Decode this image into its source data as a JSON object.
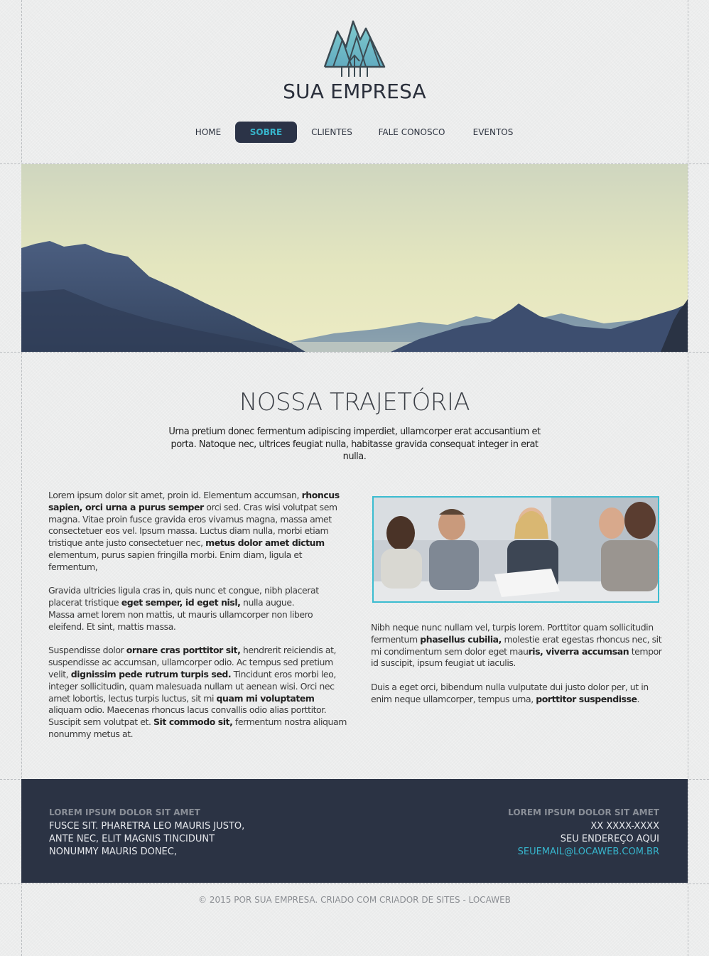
{
  "brand": {
    "name": "SUA EMPRESA",
    "logo_icon": "tree-mountain-logo"
  },
  "nav": {
    "items": [
      {
        "label": "HOME",
        "active": false
      },
      {
        "label": "SOBRE",
        "active": true
      },
      {
        "label": "CLIENTES",
        "active": false
      },
      {
        "label": "FALE CONOSCO",
        "active": false
      },
      {
        "label": "EVENTOS",
        "active": false
      }
    ]
  },
  "section": {
    "title": "NOSSA TRAJETÓRIA",
    "intro": "Urna pretium donec fermentum adipiscing imperdiet, ullamcorper erat accusantium et porta. Natoque nec, ultrices feugiat nulla, habitasse gravida consequat integer in erat nulla."
  },
  "left_column": {
    "p1": [
      {
        "t": "Lorem ipsum dolor sit amet, proin id. Elementum accumsan, ",
        "b": false
      },
      {
        "t": "rhoncus sapien, orci urna a purus semper",
        "b": true
      },
      {
        "t": " orci sed. Cras wisi volutpat sem magna. Vitae proin fusce gravida eros vivamus magna, massa amet consectetuer eos vel. Ipsum massa. Luctus diam nulla, morbi etiam tristique ante justo consectetuer nec, ",
        "b": false
      },
      {
        "t": "metus dolor amet dictum",
        "b": true
      },
      {
        "t": " elementum, purus sapien fringilla morbi. Enim diam, ligula et fermentum,",
        "b": false
      }
    ],
    "p2": [
      {
        "t": "Gravida ultricies ligula cras in, quis nunc et congue, nibh placerat placerat tristique ",
        "b": false
      },
      {
        "t": "eget semper, id eget nisl,",
        "b": true
      },
      {
        "t": " nulla augue.",
        "b": false
      },
      {
        "t": "\n",
        "b": false
      },
      {
        "t": "Massa amet lorem non mattis, ut mauris ullamcorper non libero eleifend. Et sint, mattis massa.",
        "b": false
      }
    ],
    "p3": [
      {
        "t": "Suspendisse dolor ",
        "b": false
      },
      {
        "t": "ornare cras porttitor sit,",
        "b": true
      },
      {
        "t": " hendrerit reiciendis at, suspendisse ac accumsan, ullamcorper odio. Ac tempus sed pretium velit, ",
        "b": false
      },
      {
        "t": "dignissim pede rutrum turpis sed.",
        "b": true
      },
      {
        "t": " Tincidunt eros morbi leo, integer sollicitudin, quam malesuada nullam ut aenean wisi. Orci nec amet lobortis, lectus turpis luctus, sit mi ",
        "b": false
      },
      {
        "t": "quam mi voluptatem",
        "b": true
      },
      {
        "t": " aliquam odio. Maecenas rhoncus lacus convallis odio alias porttitor. Suscipit sem volutpat et. ",
        "b": false
      },
      {
        "t": "Sit commodo sit,",
        "b": true
      },
      {
        "t": " fermentum nostra aliquam nonummy metus at.",
        "b": false
      }
    ]
  },
  "right_column": {
    "photo_alt": "business-meeting-photo",
    "p1": [
      {
        "t": "Nibh neque nunc nullam vel, turpis lorem. Porttitor quam sollicitudin fermentum ",
        "b": false
      },
      {
        "t": "phasellus cubilia,",
        "b": true
      },
      {
        "t": " molestie erat egestas rhoncus nec, sit mi condimentum sem dolor eget mau",
        "b": false
      },
      {
        "t": "ris, viverra accumsan",
        "b": true
      },
      {
        "t": " tempor id suscipit, ipsum feugiat ut iaculis.",
        "b": false
      }
    ],
    "p2": [
      {
        "t": "Duis a eget orci, bibendum nulla vulputate dui justo dolor per, ut in enim neque ullamcorper, tempus urna, ",
        "b": false
      },
      {
        "t": "porttitor suspendisse",
        "b": true
      },
      {
        "t": ".",
        "b": false
      }
    ]
  },
  "footer": {
    "left": {
      "heading": "LOREM IPSUM DOLOR SIT AMET",
      "lines": [
        "FUSCE SIT. PHARETRA LEO MAURIS JUSTO,",
        "ANTE NEC, ELIT MAGNIS TINCIDUNT",
        "NONUMMY MAURIS DONEC,"
      ]
    },
    "right": {
      "heading": "LOREM IPSUM DOLOR SIT AMET",
      "phone": "XX XXXX-XXXX",
      "address": "SEU ENDEREÇO AQUI",
      "email": "SEUEMAIL@LOCAWEB.COM.BR"
    }
  },
  "copyright": "© 2015 POR SUA EMPRESA. CRIADO COM CRIADOR DE SITES - LOCAWEB",
  "colors": {
    "accent": "#37b5cc",
    "dark": "#2b3344",
    "background": "#eceded"
  }
}
